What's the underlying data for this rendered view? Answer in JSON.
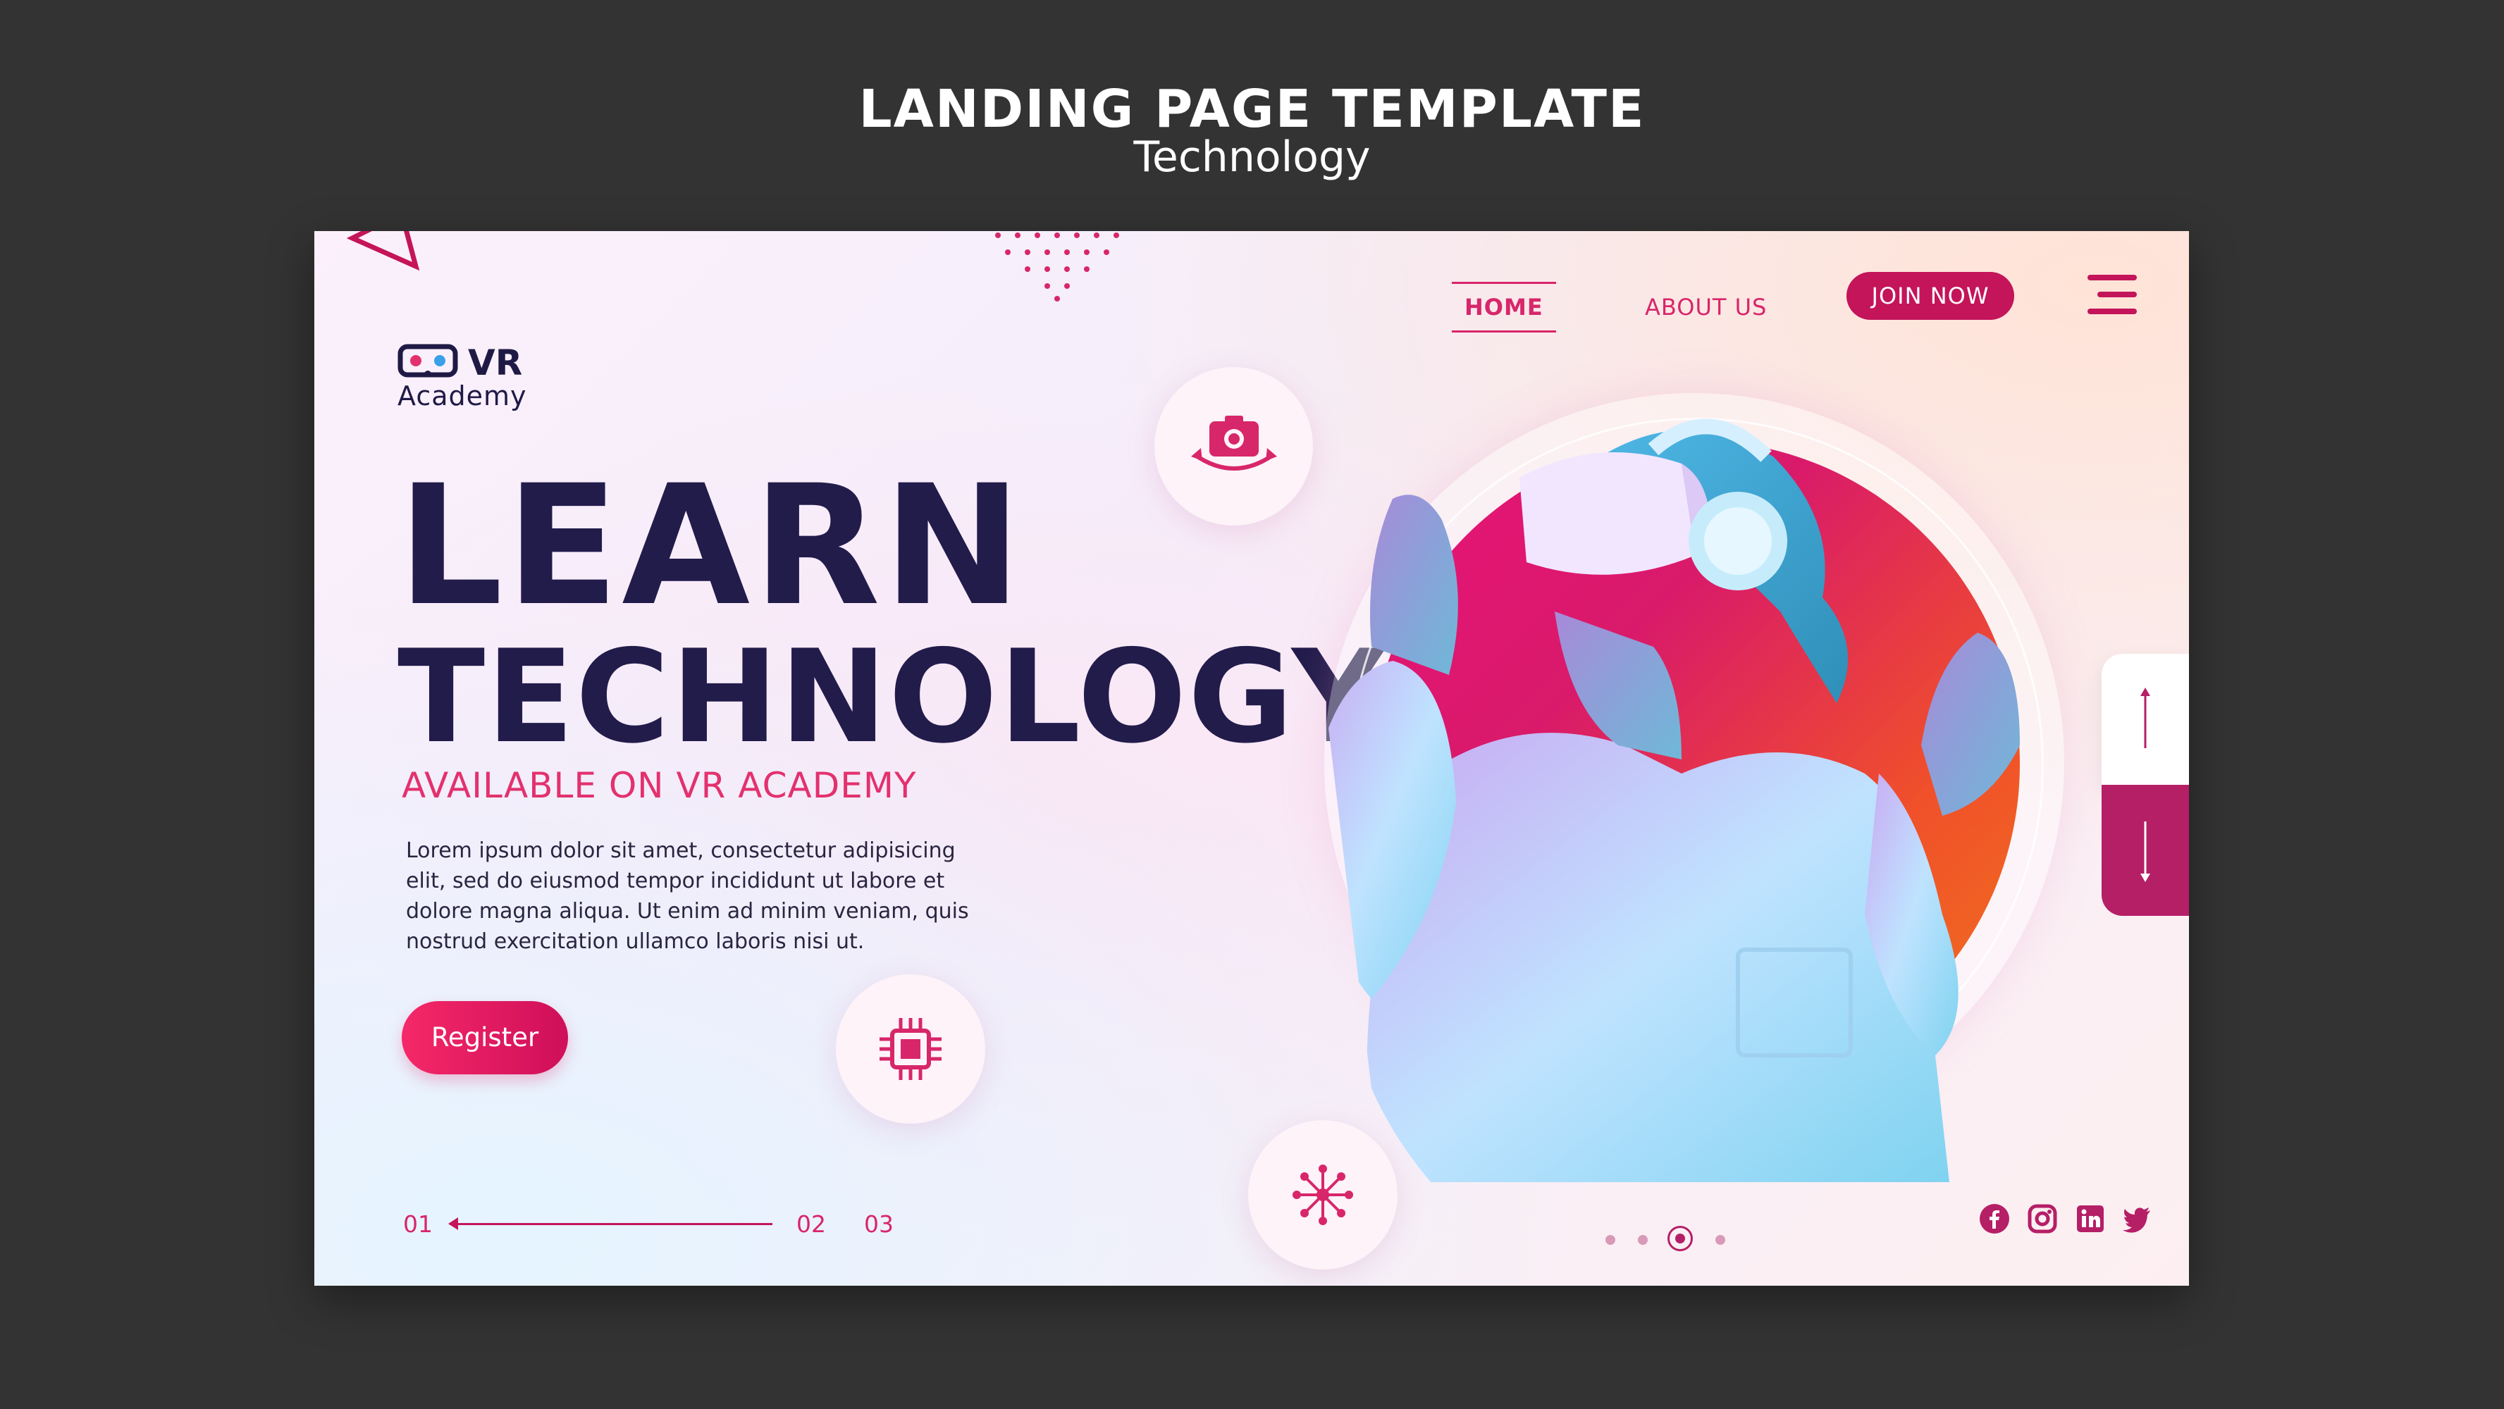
{
  "outer": {
    "title": "LANDING PAGE TEMPLATE",
    "subtitle": "Technology"
  },
  "colors": {
    "background": "#333333",
    "primary": "#c4145a",
    "accent": "#e3316e",
    "heading": "#221c4b"
  },
  "nav": {
    "home": "HOME",
    "about": "ABOUT US",
    "join": "JOIN NOW",
    "menu_icon": "hamburger-menu-icon"
  },
  "logo": {
    "icon": "vr-headset-icon",
    "vr": "VR",
    "academy": "Academy"
  },
  "hero": {
    "headline_1": "LEARN",
    "headline_2": "TECHNOLOGY",
    "subheading": "AVAILABLE ON VR ACADEMY",
    "body": "Lorem ipsum dolor sit amet, consectetur adipisicing elit, sed do eiusmod tempor incididunt ut labore et dolore magna aliqua. Ut enim ad minim veniam, quis nostrud exercitation ullamco laboris nisi ut.",
    "register": "Register"
  },
  "pager": {
    "items": [
      "01",
      "02",
      "03"
    ],
    "active": "01"
  },
  "icons": [
    "camera-360-icon",
    "cpu-chip-icon",
    "network-icon"
  ],
  "scroll": {
    "up_icon": "arrow-up-icon",
    "down_icon": "arrow-down-icon"
  },
  "carousel": {
    "count": 4,
    "active": 3
  },
  "social": [
    "facebook-icon",
    "instagram-icon",
    "linkedin-icon",
    "twitter-icon"
  ]
}
